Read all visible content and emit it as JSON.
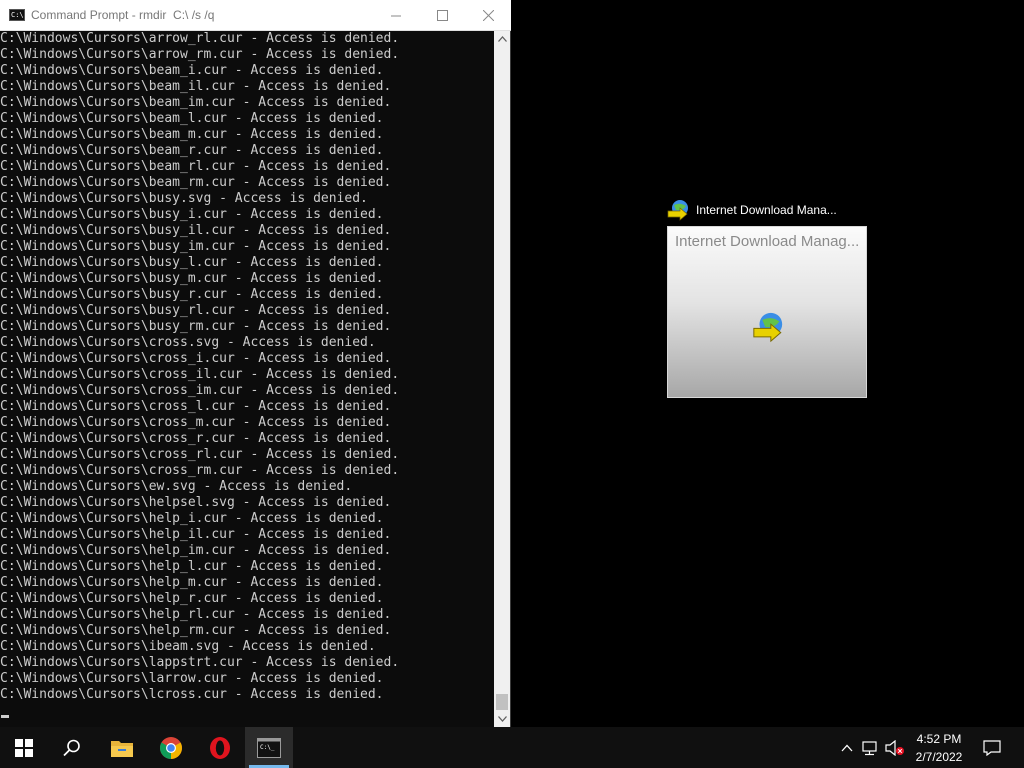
{
  "cmd": {
    "title": "Command Prompt - rmdir  C:\\ /s /q",
    "app_icon_text": "C:\\",
    "lines": [
      "C:\\Windows\\Cursors\\arrow_rl.cur - Access is denied.",
      "C:\\Windows\\Cursors\\arrow_rm.cur - Access is denied.",
      "C:\\Windows\\Cursors\\beam_i.cur - Access is denied.",
      "C:\\Windows\\Cursors\\beam_il.cur - Access is denied.",
      "C:\\Windows\\Cursors\\beam_im.cur - Access is denied.",
      "C:\\Windows\\Cursors\\beam_l.cur - Access is denied.",
      "C:\\Windows\\Cursors\\beam_m.cur - Access is denied.",
      "C:\\Windows\\Cursors\\beam_r.cur - Access is denied.",
      "C:\\Windows\\Cursors\\beam_rl.cur - Access is denied.",
      "C:\\Windows\\Cursors\\beam_rm.cur - Access is denied.",
      "C:\\Windows\\Cursors\\busy.svg - Access is denied.",
      "C:\\Windows\\Cursors\\busy_i.cur - Access is denied.",
      "C:\\Windows\\Cursors\\busy_il.cur - Access is denied.",
      "C:\\Windows\\Cursors\\busy_im.cur - Access is denied.",
      "C:\\Windows\\Cursors\\busy_l.cur - Access is denied.",
      "C:\\Windows\\Cursors\\busy_m.cur - Access is denied.",
      "C:\\Windows\\Cursors\\busy_r.cur - Access is denied.",
      "C:\\Windows\\Cursors\\busy_rl.cur - Access is denied.",
      "C:\\Windows\\Cursors\\busy_rm.cur - Access is denied.",
      "C:\\Windows\\Cursors\\cross.svg - Access is denied.",
      "C:\\Windows\\Cursors\\cross_i.cur - Access is denied.",
      "C:\\Windows\\Cursors\\cross_il.cur - Access is denied.",
      "C:\\Windows\\Cursors\\cross_im.cur - Access is denied.",
      "C:\\Windows\\Cursors\\cross_l.cur - Access is denied.",
      "C:\\Windows\\Cursors\\cross_m.cur - Access is denied.",
      "C:\\Windows\\Cursors\\cross_r.cur - Access is denied.",
      "C:\\Windows\\Cursors\\cross_rl.cur - Access is denied.",
      "C:\\Windows\\Cursors\\cross_rm.cur - Access is denied.",
      "C:\\Windows\\Cursors\\ew.svg - Access is denied.",
      "C:\\Windows\\Cursors\\helpsel.svg - Access is denied.",
      "C:\\Windows\\Cursors\\help_i.cur - Access is denied.",
      "C:\\Windows\\Cursors\\help_il.cur - Access is denied.",
      "C:\\Windows\\Cursors\\help_im.cur - Access is denied.",
      "C:\\Windows\\Cursors\\help_l.cur - Access is denied.",
      "C:\\Windows\\Cursors\\help_m.cur - Access is denied.",
      "C:\\Windows\\Cursors\\help_r.cur - Access is denied.",
      "C:\\Windows\\Cursors\\help_rl.cur - Access is denied.",
      "C:\\Windows\\Cursors\\help_rm.cur - Access is denied.",
      "C:\\Windows\\Cursors\\ibeam.svg - Access is denied.",
      "C:\\Windows\\Cursors\\lappstrt.cur - Access is denied.",
      "C:\\Windows\\Cursors\\larrow.cur - Access is denied.",
      "C:\\Windows\\Cursors\\lcross.cur - Access is denied."
    ],
    "colors": {
      "background": "#0c0c0c",
      "text": "#cccccc"
    }
  },
  "idm_preview": {
    "label": "Internet Download Mana...",
    "card_title": "Internet Download Manag..."
  },
  "taskbar": {
    "icons": [
      "windows-start-icon",
      "search-icon",
      "file-explorer-icon",
      "chrome-icon",
      "opera-icon",
      "command-prompt-icon"
    ],
    "tray_icons": [
      "chevron-up-icon",
      "network-icon",
      "volume-muted-icon",
      "notification-icon"
    ],
    "time": "4:52 PM",
    "date": "2/7/2022",
    "accent": "#76b9ed"
  }
}
